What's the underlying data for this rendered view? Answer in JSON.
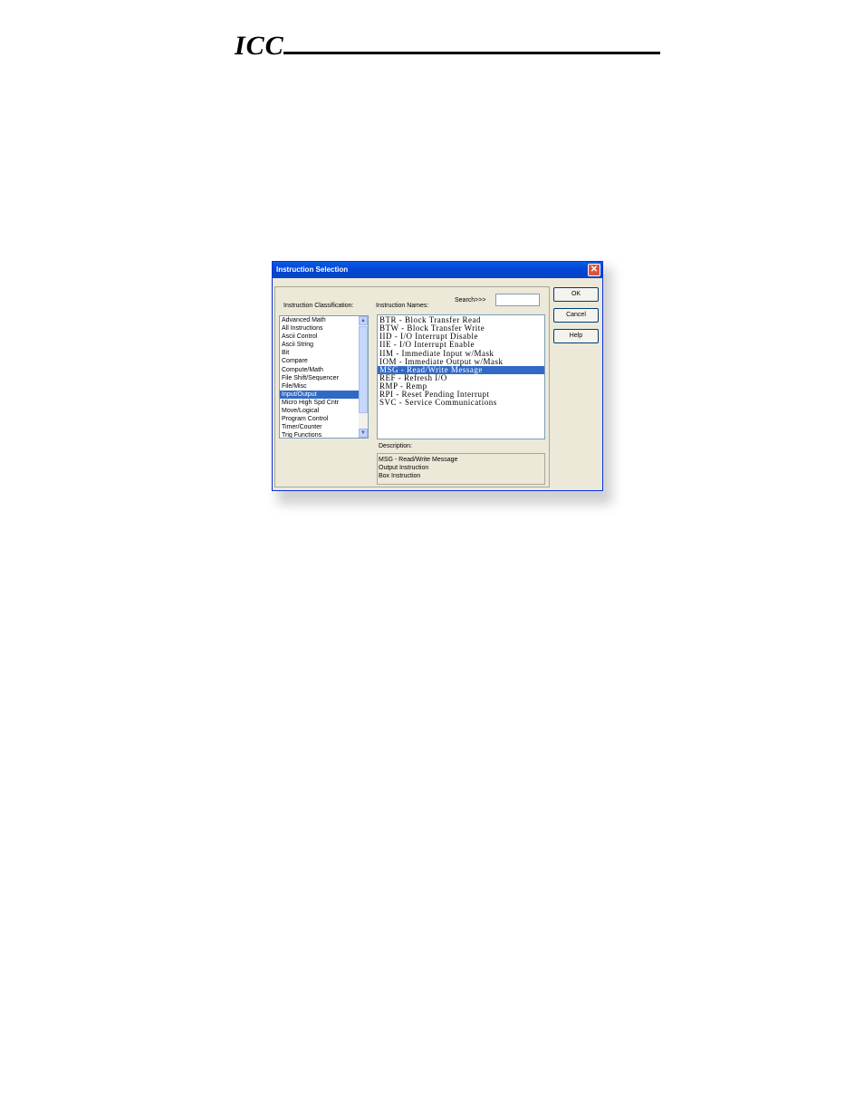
{
  "header": {
    "logo_text": "ICC"
  },
  "dialog": {
    "title": "Instruction Selection",
    "close_symbol": "✕",
    "classification_label": "Instruction Classification:",
    "names_label": "Instruction Names:",
    "search_label": "Search>>>",
    "search_value": "",
    "classifications": [
      "Advanced Math",
      "All Instructions",
      "Ascii Control",
      "Ascii String",
      "Bit",
      "Compare",
      "Compute/Math",
      "File Shift/Sequencer",
      "File/Misc",
      "Input/Output",
      "Micro High Spd Cntr",
      "Move/Logical",
      "Program Control",
      "Timer/Counter",
      "Trig Functions"
    ],
    "selected_classification": "Input/Output",
    "instruction_names": [
      "BTR - Block Transfer Read",
      "BTW - Block Transfer Write",
      "IID - I/O Interrupt Disable",
      "IIE - I/O Interrupt Enable",
      "IIM - Immediate Input w/Mask",
      "IOM - Immediate Output w/Mask",
      "MSG - Read/Write Message",
      "REF - Refresh I/O",
      "RMP - Remp",
      "RPI - Reset Pending Interrupt",
      "SVC - Service Communications"
    ],
    "selected_instruction": "MSG - Read/Write Message",
    "description_label": "Description:",
    "description_lines": [
      "MSG - Read/Write Message",
      "Output Instruction",
      "Box Instruction"
    ],
    "buttons": {
      "ok": "OK",
      "cancel": "Cancel",
      "help": "Help"
    },
    "scroll_up_symbol": "▲",
    "scroll_down_symbol": "▼"
  }
}
